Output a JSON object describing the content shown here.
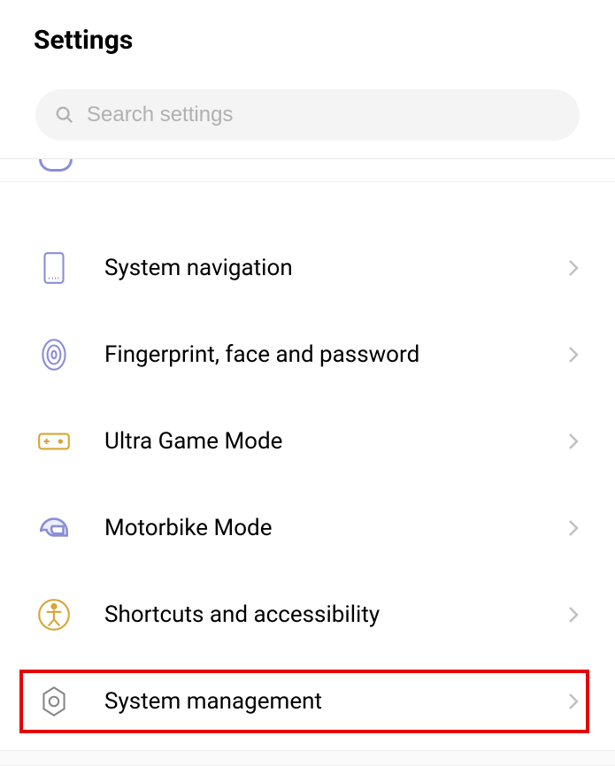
{
  "header": {
    "title": "Settings"
  },
  "search": {
    "placeholder": "Search settings"
  },
  "items": [
    {
      "label": "System navigation"
    },
    {
      "label": "Fingerprint, face and password"
    },
    {
      "label": "Ultra Game Mode"
    },
    {
      "label": "Motorbike Mode"
    },
    {
      "label": "Shortcuts and accessibility"
    },
    {
      "label": "System management",
      "highlighted": true
    }
  ]
}
